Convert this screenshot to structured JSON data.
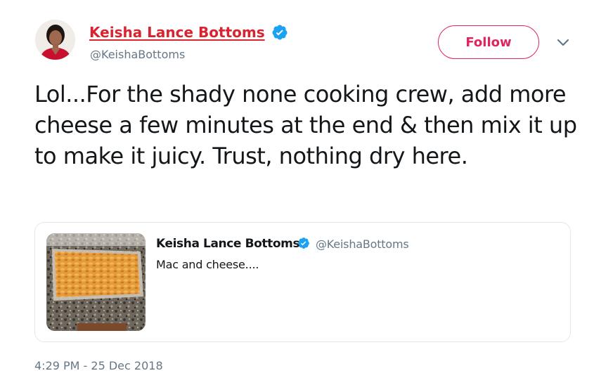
{
  "author": {
    "display_name": "Keisha Lance Bottoms",
    "handle": "@KeishaBottoms",
    "verified_icon": "verified-badge-icon"
  },
  "actions": {
    "follow_label": "Follow",
    "menu_icon": "chevron-down-icon"
  },
  "tweet": {
    "text": "Lol...For the shady none cooking crew, add more cheese a few minutes at the end & then mix it up to make it juicy. Trust, nothing dry here.",
    "timestamp": "4:29 PM - 25 Dec 2018"
  },
  "quoted_tweet": {
    "display_name": "Keisha Lance Bottoms",
    "handle": "@KeishaBottoms",
    "text": "Mac and cheese....",
    "image_icon": "mac-and-cheese-photo"
  },
  "colors": {
    "accent": "#e0245e",
    "name_link": "#d9232e",
    "verified": "#1da1f2",
    "secondary_text": "#657786",
    "border": "#e1e8ed"
  }
}
